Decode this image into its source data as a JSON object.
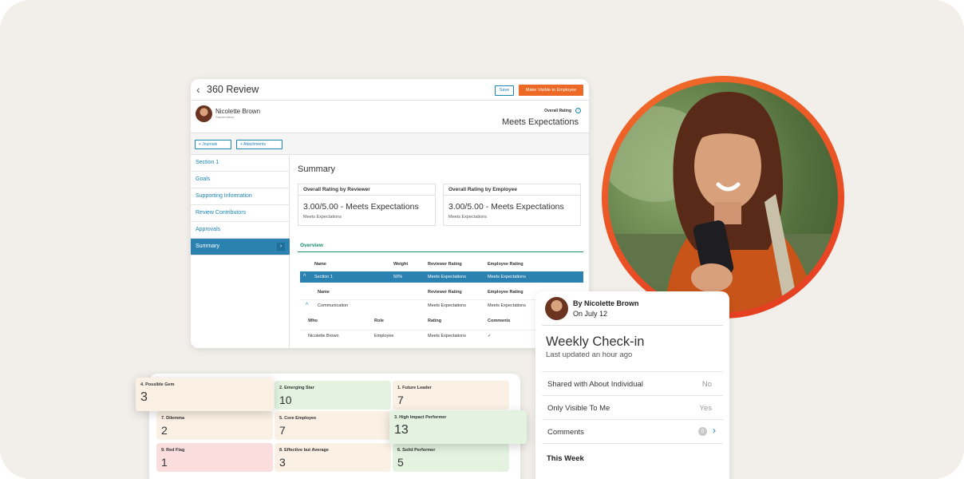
{
  "review": {
    "back": "‹",
    "title": "360 Review",
    "save_label": "Save",
    "visible_label": "Make Visible to Employee",
    "employee_name": "Nicolette Brown",
    "employee_sub": "Stachenfiens",
    "overall_label": "Overall Rating",
    "overall_value": "Meets Expectations",
    "journals_label": "+ Journals",
    "attachments_label": "+ Attachments",
    "sidebar": [
      "Section 1",
      "Goals",
      "Supporting Information",
      "Review Contributors",
      "Approvals",
      "Summary"
    ],
    "summary_title": "Summary",
    "box1_title": "Overall Rating by Reviewer",
    "box1_value": "3.00/5.00 - Meets Expectations",
    "box1_sub": "Meets Expectations",
    "box2_title": "Overall Rating by Employee",
    "box2_value": "3.00/5.00 - Meets Expectations",
    "box2_sub": "Meets Expectations",
    "overview_tab": "Overview",
    "table_head": [
      "Name",
      "Weight",
      "Reviewer Rating",
      "Employee Rating"
    ],
    "section_row": [
      "^",
      "Section 1",
      "50%",
      "Meets Expectations",
      "Meets Expectations"
    ],
    "sub_head": [
      "Name",
      "Reviewer Rating",
      "Employee Rating"
    ],
    "comm_row": [
      "^",
      "Communication",
      "Meets Expectations",
      "Meets Expectations"
    ],
    "who_head": [
      "Who",
      "Role",
      "Rating",
      "Comments"
    ],
    "who_row": [
      "Nicolette Brown",
      "Employee",
      "Meets Expectations",
      "✓"
    ]
  },
  "ninebox": [
    {
      "title": "4. Possible Gem",
      "value": "3"
    },
    {
      "title": "2. Emerging Star",
      "value": "10"
    },
    {
      "title": "1. Future Leader",
      "value": "7"
    },
    {
      "title": "7. Dilemma",
      "value": "2"
    },
    {
      "title": "5. Core Employee",
      "value": "7"
    },
    {
      "title": "3. High Impact Performer",
      "value": "13"
    },
    {
      "title": "9. Red Flag",
      "value": "1"
    },
    {
      "title": "8. Effective but Average",
      "value": "3"
    },
    {
      "title": "6. Solid Performer",
      "value": "5"
    }
  ],
  "checkin": {
    "by": "By Nicolette Brown",
    "on": "On July 12",
    "title": "Weekly Check-in",
    "updated": "Last updated an hour ago",
    "shared_label": "Shared with About Individual",
    "shared_value": "No",
    "visible_label": "Only Visible To Me",
    "visible_value": "Yes",
    "comments_label": "Comments",
    "comments_count": "0",
    "week_label": "This Week"
  },
  "colors": {
    "accent": "#1b85b8",
    "orange": "#ec6a25",
    "green": "#1a8d6b"
  }
}
